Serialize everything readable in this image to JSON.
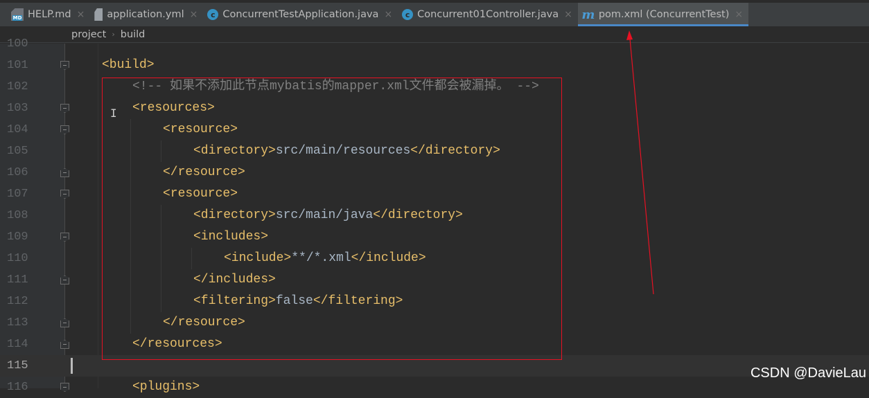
{
  "tabs": [
    {
      "label": "HELP.md",
      "icon": "markdown-file-icon",
      "active": false
    },
    {
      "label": "application.yml",
      "icon": "yaml-file-icon",
      "active": false
    },
    {
      "label": "ConcurrentTestApplication.java",
      "icon": "spring-boot-class-icon",
      "active": false
    },
    {
      "label": "Concurrent01Controller.java",
      "icon": "java-class-icon",
      "active": false
    },
    {
      "label": "pom.xml (ConcurrentTest)",
      "icon": "maven-pom-icon",
      "active": true
    }
  ],
  "tab_close": "×",
  "breadcrumb": {
    "items": [
      "project",
      "build"
    ],
    "separator": "›"
  },
  "editor": {
    "current_line": 115,
    "lines": [
      {
        "num": "100",
        "indent": 0,
        "parts": []
      },
      {
        "num": "101",
        "indent": 0,
        "fold": "open",
        "parts": [
          {
            "c": "tag",
            "v": "<build>"
          }
        ]
      },
      {
        "num": "102",
        "indent": 1,
        "parts": [
          {
            "c": "cmt",
            "v": "<!-- 如果不添加此节点mybatis的mapper.xml文件都会被漏掉。 -->"
          }
        ]
      },
      {
        "num": "103",
        "indent": 1,
        "fold": "open",
        "parts": [
          {
            "c": "tag",
            "v": "<resources>"
          }
        ]
      },
      {
        "num": "104",
        "indent": 2,
        "fold": "open",
        "parts": [
          {
            "c": "tag",
            "v": "<resource>"
          }
        ]
      },
      {
        "num": "105",
        "indent": 3,
        "parts": [
          {
            "c": "tag",
            "v": "<directory>"
          },
          {
            "c": "txt",
            "v": "src/main/resources"
          },
          {
            "c": "tag",
            "v": "</directory>"
          }
        ]
      },
      {
        "num": "106",
        "indent": 2,
        "fold": "close",
        "parts": [
          {
            "c": "tag",
            "v": "</resource>"
          }
        ]
      },
      {
        "num": "107",
        "indent": 2,
        "fold": "open",
        "parts": [
          {
            "c": "tag",
            "v": "<resource>"
          }
        ]
      },
      {
        "num": "108",
        "indent": 3,
        "parts": [
          {
            "c": "tag",
            "v": "<directory>"
          },
          {
            "c": "txt",
            "v": "src/main/java"
          },
          {
            "c": "tag",
            "v": "</directory>"
          }
        ]
      },
      {
        "num": "109",
        "indent": 3,
        "fold": "open",
        "parts": [
          {
            "c": "tag",
            "v": "<includes>"
          }
        ]
      },
      {
        "num": "110",
        "indent": 4,
        "parts": [
          {
            "c": "tag",
            "v": "<include>"
          },
          {
            "c": "txt",
            "v": "**/*.xml"
          },
          {
            "c": "tag",
            "v": "</include>"
          }
        ]
      },
      {
        "num": "111",
        "indent": 3,
        "fold": "close",
        "parts": [
          {
            "c": "tag",
            "v": "</includes>"
          }
        ]
      },
      {
        "num": "112",
        "indent": 3,
        "parts": [
          {
            "c": "tag",
            "v": "<filtering>"
          },
          {
            "c": "txt",
            "v": "false"
          },
          {
            "c": "tag",
            "v": "</filtering>"
          }
        ]
      },
      {
        "num": "113",
        "indent": 2,
        "fold": "close",
        "parts": [
          {
            "c": "tag",
            "v": "</resource>"
          }
        ]
      },
      {
        "num": "114",
        "indent": 1,
        "fold": "close",
        "parts": [
          {
            "c": "tag",
            "v": "</resources>"
          }
        ]
      },
      {
        "num": "115",
        "indent": 0,
        "parts": []
      },
      {
        "num": "116",
        "indent": 1,
        "fold": "open",
        "parts": [
          {
            "c": "tag",
            "v": "<plugins>"
          }
        ]
      }
    ]
  },
  "watermark": "CSDN @DavieLau",
  "colors": {
    "annotation": "#e81123",
    "tag": "#e8bf6a",
    "text": "#a9b7c6",
    "comment": "#808080"
  }
}
